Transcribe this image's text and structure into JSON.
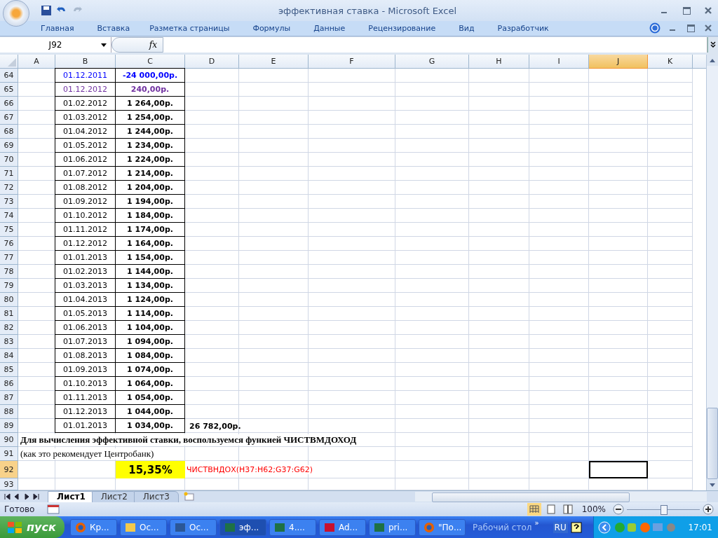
{
  "window": {
    "title": "эффективная ставка - Microsoft Excel"
  },
  "ribbon_tabs": [
    "Главная",
    "Вставка",
    "Разметка страницы",
    "Формулы",
    "Данные",
    "Рецензирование",
    "Вид",
    "Разработчик"
  ],
  "formula_bar": {
    "name_box": "J92",
    "fx": "fx"
  },
  "columns": [
    {
      "label": "A",
      "selected": false
    },
    {
      "label": "B",
      "selected": false
    },
    {
      "label": "C",
      "selected": false
    },
    {
      "label": "D",
      "selected": false
    },
    {
      "label": "E",
      "selected": false
    },
    {
      "label": "F",
      "selected": false
    },
    {
      "label": "G",
      "selected": false
    },
    {
      "label": "H",
      "selected": false
    },
    {
      "label": "I",
      "selected": false
    },
    {
      "label": "J",
      "selected": true
    },
    {
      "label": "K",
      "selected": false
    }
  ],
  "rows": [
    {
      "row": "64",
      "b": "01.12.2011",
      "c": "-24 000,00р.",
      "color": "#0000ff"
    },
    {
      "row": "65",
      "b": "01.12.2012",
      "c": "240,00р.",
      "color": "#7030a0"
    },
    {
      "row": "66",
      "b": "01.02.2012",
      "c": "1 264,00р.",
      "color": "#000000"
    },
    {
      "row": "67",
      "b": "01.03.2012",
      "c": "1 254,00р.",
      "color": "#000000"
    },
    {
      "row": "68",
      "b": "01.04.2012",
      "c": "1 244,00р.",
      "color": "#000000"
    },
    {
      "row": "69",
      "b": "01.05.2012",
      "c": "1 234,00р.",
      "color": "#000000"
    },
    {
      "row": "70",
      "b": "01.06.2012",
      "c": "1 224,00р.",
      "color": "#000000"
    },
    {
      "row": "71",
      "b": "01.07.2012",
      "c": "1 214,00р.",
      "color": "#000000"
    },
    {
      "row": "72",
      "b": "01.08.2012",
      "c": "1 204,00р.",
      "color": "#000000"
    },
    {
      "row": "73",
      "b": "01.09.2012",
      "c": "1 194,00р.",
      "color": "#000000"
    },
    {
      "row": "74",
      "b": "01.10.2012",
      "c": "1 184,00р.",
      "color": "#000000"
    },
    {
      "row": "75",
      "b": "01.11.2012",
      "c": "1 174,00р.",
      "color": "#000000"
    },
    {
      "row": "76",
      "b": "01.12.2012",
      "c": "1 164,00р.",
      "color": "#000000"
    },
    {
      "row": "77",
      "b": "01.01.2013",
      "c": "1 154,00р.",
      "color": "#000000"
    },
    {
      "row": "78",
      "b": "01.02.2013",
      "c": "1 144,00р.",
      "color": "#000000"
    },
    {
      "row": "79",
      "b": "01.03.2013",
      "c": "1 134,00р.",
      "color": "#000000"
    },
    {
      "row": "80",
      "b": "01.04.2013",
      "c": "1 124,00р.",
      "color": "#000000"
    },
    {
      "row": "81",
      "b": "01.05.2013",
      "c": "1 114,00р.",
      "color": "#000000"
    },
    {
      "row": "82",
      "b": "01.06.2013",
      "c": "1 104,00р.",
      "color": "#000000"
    },
    {
      "row": "83",
      "b": "01.07.2013",
      "c": "1 094,00р.",
      "color": "#000000"
    },
    {
      "row": "84",
      "b": "01.08.2013",
      "c": "1 084,00р.",
      "color": "#000000"
    },
    {
      "row": "85",
      "b": "01.09.2013",
      "c": "1 074,00р.",
      "color": "#000000"
    },
    {
      "row": "86",
      "b": "01.10.2013",
      "c": "1 064,00р.",
      "color": "#000000"
    },
    {
      "row": "87",
      "b": "01.11.2013",
      "c": "1 054,00р.",
      "color": "#000000"
    },
    {
      "row": "88",
      "b": "01.12.2013",
      "c": "1 044,00р.",
      "color": "#000000"
    },
    {
      "row": "89",
      "b": "01.01.2013",
      "c": "1 034,00р.",
      "color": "#000000",
      "d": "26 782,00р."
    }
  ],
  "notes": [
    {
      "row": "90",
      "text": "Для вычисления эффективной ставки, воспользуемся функией ЧИСТВМДОХОД",
      "bold": true
    },
    {
      "row": "91",
      "text": "(как это рекомендует Центробанк)",
      "bold": false
    }
  ],
  "result": {
    "row": "92",
    "value": "15,35%",
    "formula": "ЧИСТВНДОХ(H37:H62;G37:G62)",
    "selected": true
  },
  "empty_row": "93",
  "sheet_tabs": [
    {
      "label": "Лист1",
      "selected": true
    },
    {
      "label": "Лист2",
      "selected": false
    },
    {
      "label": "Лист3",
      "selected": false
    }
  ],
  "status_bar": {
    "text": "Готово",
    "zoom": "100%",
    "level": 0.5
  },
  "taskbar": {
    "start": "пуск",
    "items": [
      {
        "label": "Кр...",
        "kind": "firefox",
        "selected": false
      },
      {
        "label": "Ос...",
        "kind": "folder",
        "selected": false
      },
      {
        "label": "Ос...",
        "kind": "word",
        "selected": false
      },
      {
        "label": "эф...",
        "kind": "excel",
        "selected": true
      },
      {
        "label": "4....",
        "kind": "excel",
        "selected": false
      },
      {
        "label": "Ad...",
        "kind": "acrobat",
        "selected": false
      },
      {
        "label": "pri...",
        "kind": "excel",
        "selected": false
      },
      {
        "label": "\"По...",
        "kind": "firefox",
        "selected": false
      }
    ],
    "desktop": "Рабочий стол",
    "chevron": "»",
    "lang": "RU",
    "clock": "17:01"
  }
}
